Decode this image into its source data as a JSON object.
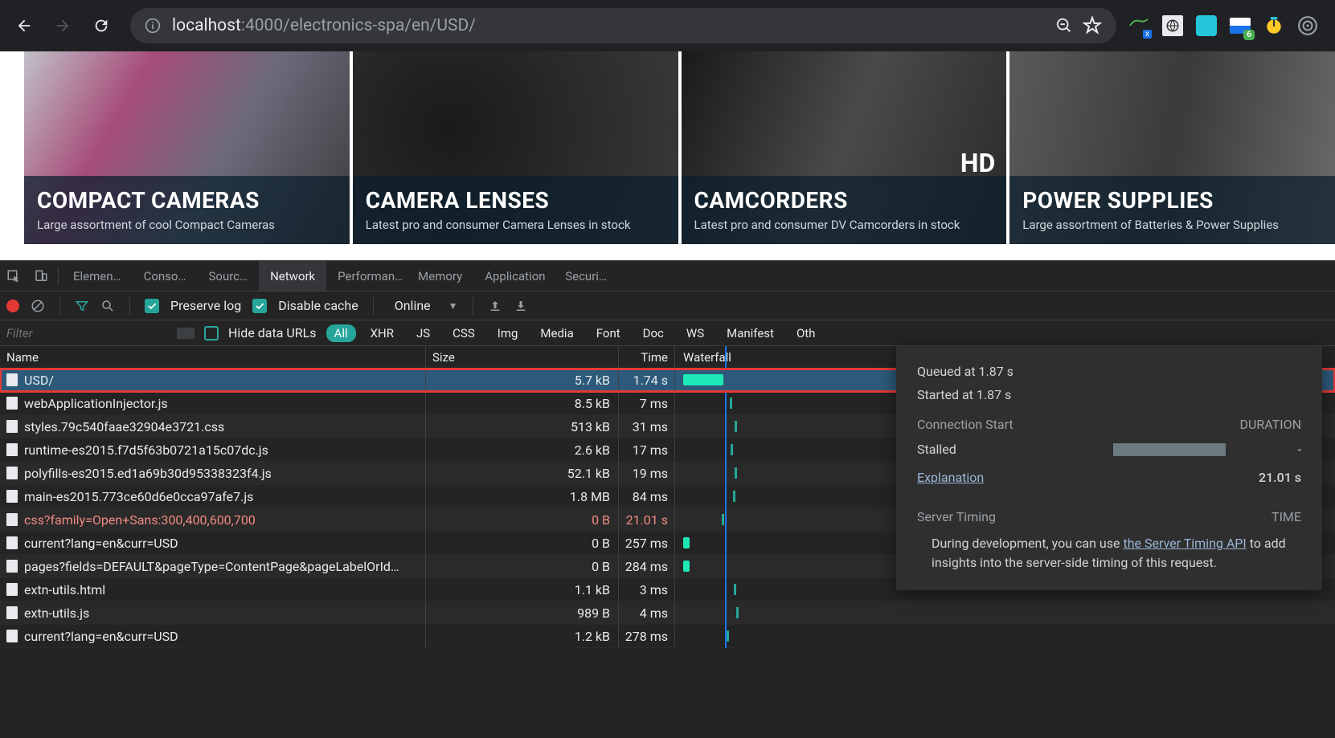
{
  "url": {
    "host": "localhost",
    "path": ":4000/electronics-spa/en/USD/"
  },
  "categories": [
    {
      "title": "COMPACT CAMERAS",
      "sub": "Large assortment of cool Compact Cameras"
    },
    {
      "title": "CAMERA LENSES",
      "sub": "Latest pro and consumer Camera Lenses in stock"
    },
    {
      "title": "CAMCORDERS",
      "sub": "Latest pro and consumer DV Camcorders in stock"
    },
    {
      "title": "POWER SUPPLIES",
      "sub": "Large assortment of Batteries & Power Supplies"
    }
  ],
  "devtools_tabs": [
    "Elemen…",
    "Conso…",
    "Sourc…",
    "Network",
    "Performan…",
    "Memory",
    "Application",
    "Securi…"
  ],
  "active_tab": "Network",
  "toolbar": {
    "preserve_log": "Preserve log",
    "disable_cache": "Disable cache",
    "online": "Online"
  },
  "filter": {
    "placeholder": "Filter",
    "hide_data_urls": "Hide data URLs",
    "types": [
      "All",
      "XHR",
      "JS",
      "CSS",
      "Img",
      "Media",
      "Font",
      "Doc",
      "WS",
      "Manifest",
      "Oth"
    ]
  },
  "columns": {
    "name": "Name",
    "size": "Size",
    "time": "Time",
    "waterfall": "Waterfall"
  },
  "requests": [
    {
      "name": "USD/",
      "size": "5.7 kB",
      "time": "1.74 s",
      "wf_width": 50,
      "selected": true,
      "highlighted": true
    },
    {
      "name": "webApplicationInjector.js",
      "size": "8.5 kB",
      "time": "7 ms",
      "wf_width": 3
    },
    {
      "name": "styles.79c540faae32904e3721.css",
      "size": "513 kB",
      "time": "31 ms",
      "wf_width": 3
    },
    {
      "name": "runtime-es2015.f7d5f63b0721a15c07dc.js",
      "size": "2.6 kB",
      "time": "17 ms",
      "wf_width": 3
    },
    {
      "name": "polyfills-es2015.ed1a69b30d95338323f4.js",
      "size": "52.1 kB",
      "time": "19 ms",
      "wf_width": 3
    },
    {
      "name": "main-es2015.773ce60d6e0cca97afe7.js",
      "size": "1.8 MB",
      "time": "84 ms",
      "wf_width": 3
    },
    {
      "name": "css?family=Open+Sans:300,400,600,700",
      "size": "0 B",
      "time": "21.01 s",
      "wf_width": 0,
      "error": true
    },
    {
      "name": "current?lang=en&curr=USD",
      "size": "0 B",
      "time": "257 ms",
      "wf_width": 8
    },
    {
      "name": "pages?fields=DEFAULT&pageType=ContentPage&pageLabelOrId…",
      "size": "0 B",
      "time": "284 ms",
      "wf_width": 8
    },
    {
      "name": "extn-utils.html",
      "size": "1.1 kB",
      "time": "3 ms",
      "wf_width": 3
    },
    {
      "name": "extn-utils.js",
      "size": "989 B",
      "time": "4 ms",
      "wf_width": 3
    },
    {
      "name": "current?lang=en&curr=USD",
      "size": "1.2 kB",
      "time": "278 ms",
      "wf_width": 3
    }
  ],
  "timing": {
    "queued": "Queued at 1.87 s",
    "started": "Started at 1.87 s",
    "connection_start": "Connection Start",
    "duration": "DURATION",
    "stalled": "Stalled",
    "stalled_val": "-",
    "explanation": "Explanation",
    "explanation_val": "21.01 s",
    "server_timing": "Server Timing",
    "time_label": "TIME",
    "note_pre": "During development, you can use ",
    "note_link": "the Server Timing API",
    "note_post": " to add insights into the server-side timing of this request."
  },
  "ext_badge": "6"
}
